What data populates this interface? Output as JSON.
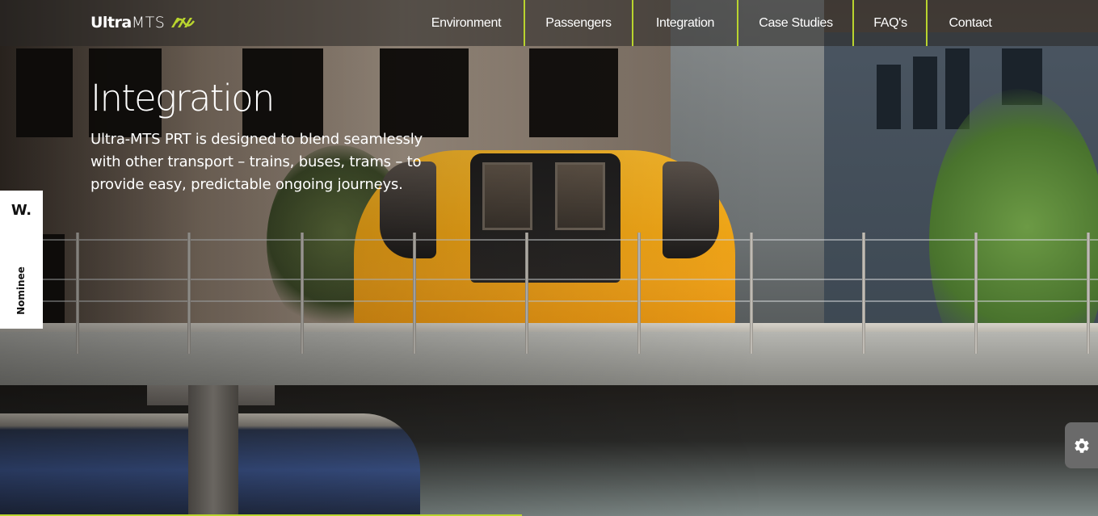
{
  "logo": {
    "strong": "Ultra",
    "light": "MTS",
    "mark_icon": "ultra-mark-icon"
  },
  "nav": {
    "items": [
      {
        "label": "Environment"
      },
      {
        "label": "Passengers"
      },
      {
        "label": "Integration"
      },
      {
        "label": "Case Studies"
      },
      {
        "label": "FAQ's"
      },
      {
        "label": "Contact"
      }
    ]
  },
  "hero": {
    "title": "Integration",
    "intro": "Ultra-MTS PRT is designed to blend seamlessly with other transport – trains, buses, trams – to provide easy, predictable ongoing journeys."
  },
  "badge": {
    "letter": "W.",
    "label": "Nominee"
  },
  "settings": {
    "icon": "gear-icon"
  },
  "colors": {
    "accent": "#b9d42e",
    "pod": "#f1a616"
  }
}
